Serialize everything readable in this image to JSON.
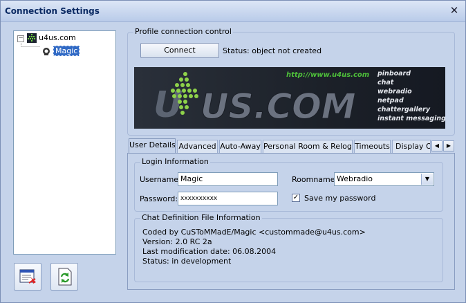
{
  "window": {
    "title": "Connection Settings",
    "close_glyph": "✕"
  },
  "tree": {
    "root_expander": "−",
    "root_label": "u4us.com",
    "child_label": "Magic"
  },
  "profile": {
    "legend": "Profile connection control",
    "connect_label": "Connect",
    "status_text": "Status: object not created"
  },
  "banner": {
    "url": "http://www.u4us.com",
    "logo_text": "US.COM",
    "features": [
      "pinboard",
      "chat",
      "webradio",
      "netpad",
      "chattergallery",
      "instant messaging"
    ]
  },
  "tabs": {
    "items": [
      "User Details",
      "Advanced",
      "Auto-Away",
      "Personal Room & Relogin",
      "Timeouts",
      "Display Op"
    ],
    "active": 0,
    "prev_glyph": "◀",
    "next_glyph": "▶"
  },
  "login": {
    "legend": "Login Information",
    "username_label": "Username:",
    "username_value": "Magic",
    "password_label": "Password:",
    "password_value": "xxxxxxxxxx",
    "roomname_label": "Roomname:",
    "roomname_value": "Webradio",
    "save_password_label": "Save my password",
    "save_password_checked": true
  },
  "chatdef": {
    "legend": "Chat Definition File Information",
    "lines": [
      "Coded by CuSToMMadE/Magic <custommade@u4us.com>",
      "Version: 2.0 RC 2a",
      "Last modification date: 06.08.2004",
      "Status: in development"
    ]
  },
  "colors": {
    "window_bg": "#c5d3ea",
    "selection": "#316ac5",
    "banner_url": "#4ec03a"
  }
}
